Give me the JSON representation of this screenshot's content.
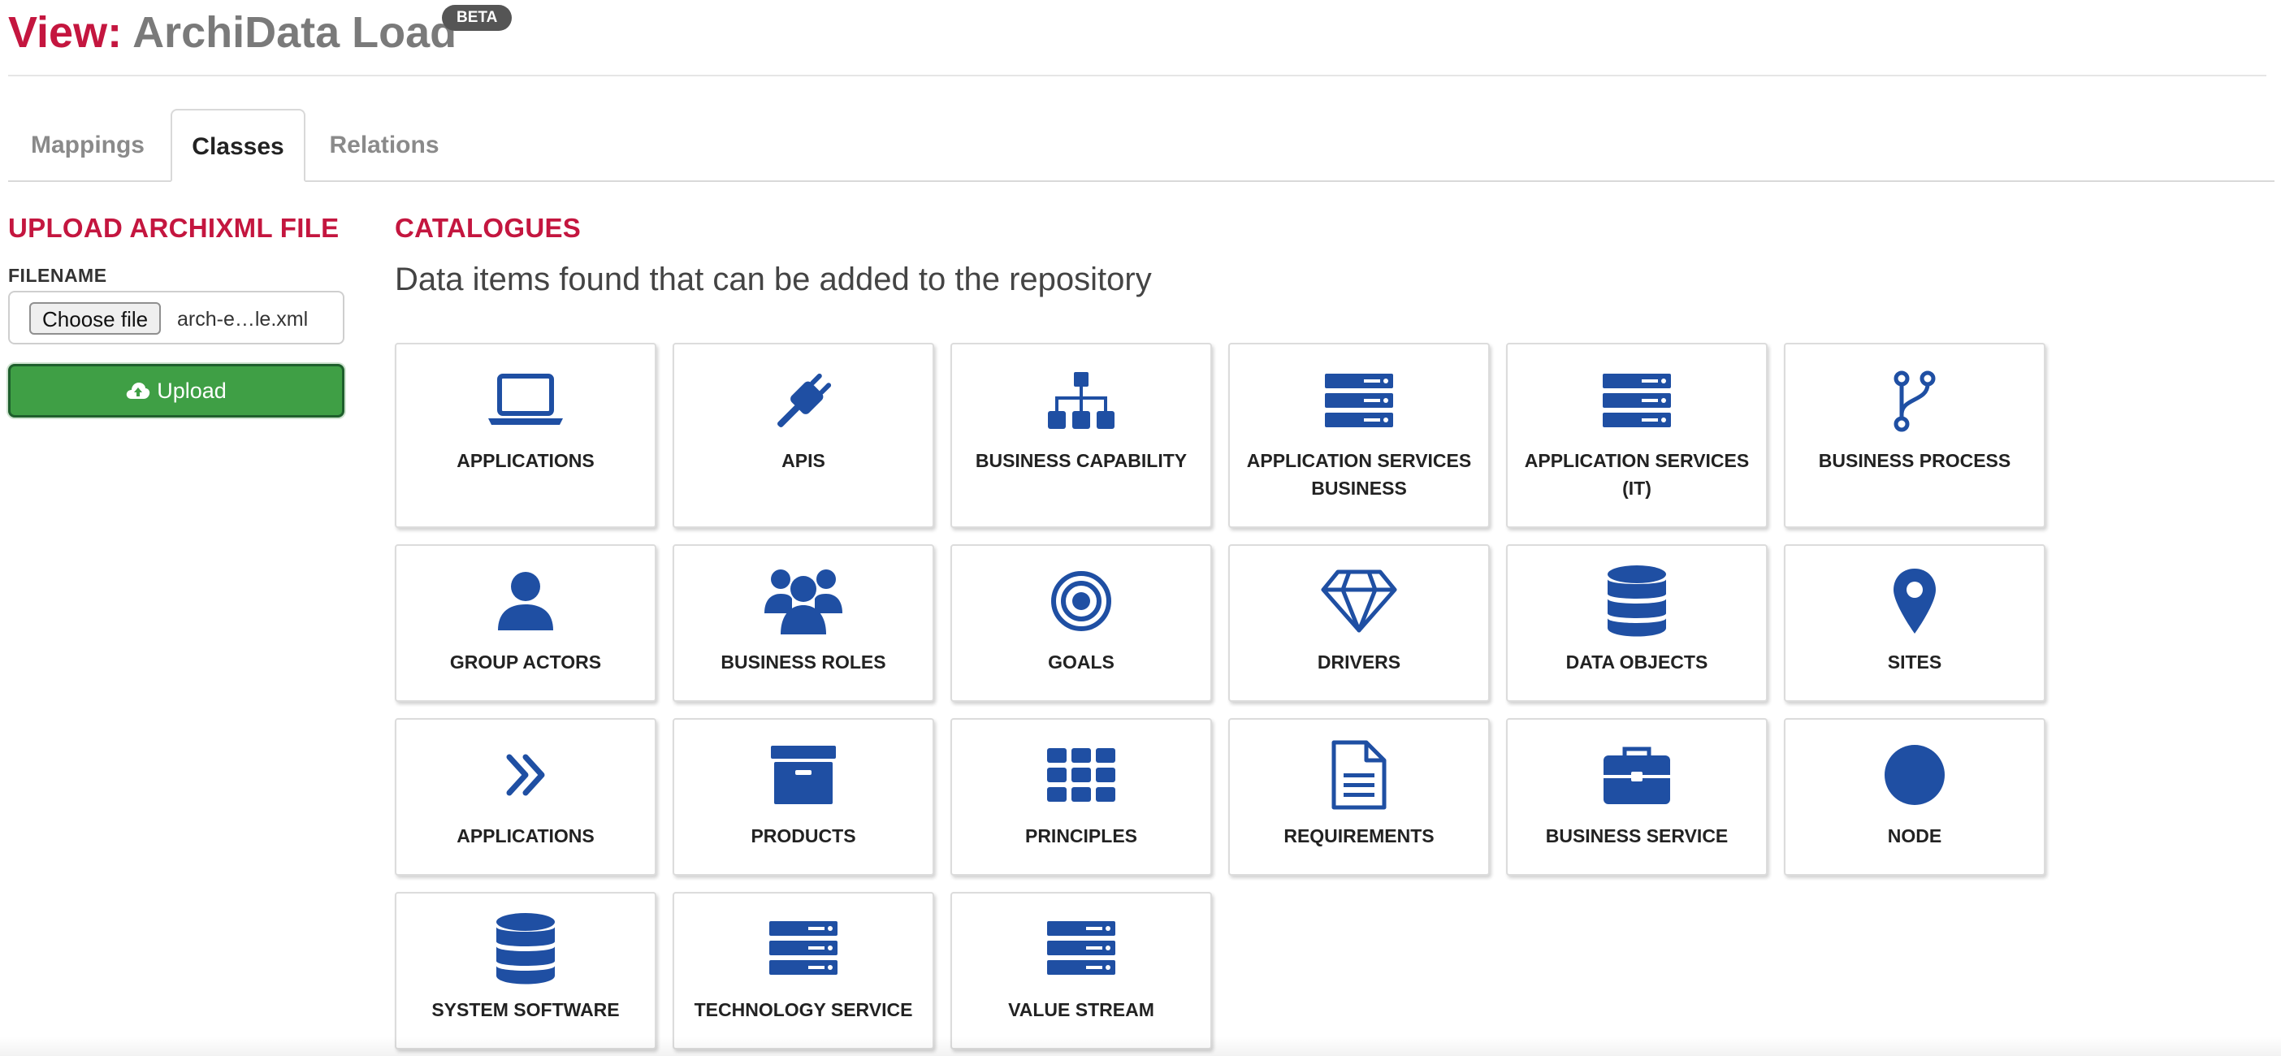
{
  "header": {
    "view_label": "View:",
    "view_name": "ArchiData Load",
    "badge": "BETA"
  },
  "tabs": [
    {
      "label": "Mappings",
      "active": false
    },
    {
      "label": "Classes",
      "active": true
    },
    {
      "label": "Relations",
      "active": false
    }
  ],
  "upload": {
    "heading": "UPLOAD ARCHIXML FILE",
    "filename_label": "FILENAME",
    "choose_file_label": "Choose file",
    "file_name": "arch-e…le.xml",
    "upload_label": "Upload"
  },
  "catalogues": {
    "heading": "CATALOGUES",
    "description": "Data items found that can be added to the repository",
    "items": [
      {
        "label": "APPLICATIONS",
        "icon": "laptop-icon"
      },
      {
        "label": "APIS",
        "icon": "plug-icon"
      },
      {
        "label": "BUSINESS CAPABILITY",
        "icon": "sitemap-icon"
      },
      {
        "label": "APPLICATION SERVICES BUSINESS",
        "icon": "server-icon"
      },
      {
        "label": "APPLICATION SERVICES (IT)",
        "icon": "server-icon"
      },
      {
        "label": "BUSINESS PROCESS",
        "icon": "code-branch-icon"
      },
      {
        "label": "GROUP ACTORS",
        "icon": "user-icon"
      },
      {
        "label": "BUSINESS ROLES",
        "icon": "users-icon"
      },
      {
        "label": "GOALS",
        "icon": "bullseye-icon"
      },
      {
        "label": "DRIVERS",
        "icon": "diamond-icon"
      },
      {
        "label": "DATA OBJECTS",
        "icon": "database-icon"
      },
      {
        "label": "SITES",
        "icon": "map-marker-icon"
      },
      {
        "label": "APPLICATIONS",
        "icon": "double-chevron-right-icon"
      },
      {
        "label": "PRODUCTS",
        "icon": "archive-box-icon"
      },
      {
        "label": "PRINCIPLES",
        "icon": "grid-icon"
      },
      {
        "label": "REQUIREMENTS",
        "icon": "document-icon"
      },
      {
        "label": "BUSINESS SERVICE",
        "icon": "briefcase-icon"
      },
      {
        "label": "NODE",
        "icon": "circle-icon"
      },
      {
        "label": "SYSTEM SOFTWARE",
        "icon": "database-icon"
      },
      {
        "label": "TECHNOLOGY SERVICE",
        "icon": "server-icon"
      },
      {
        "label": "VALUE STREAM",
        "icon": "server-icon"
      }
    ]
  },
  "colors": {
    "brand_red": "#c4163f",
    "icon_blue": "#1f4fa3",
    "upload_green": "#3f9f45"
  }
}
